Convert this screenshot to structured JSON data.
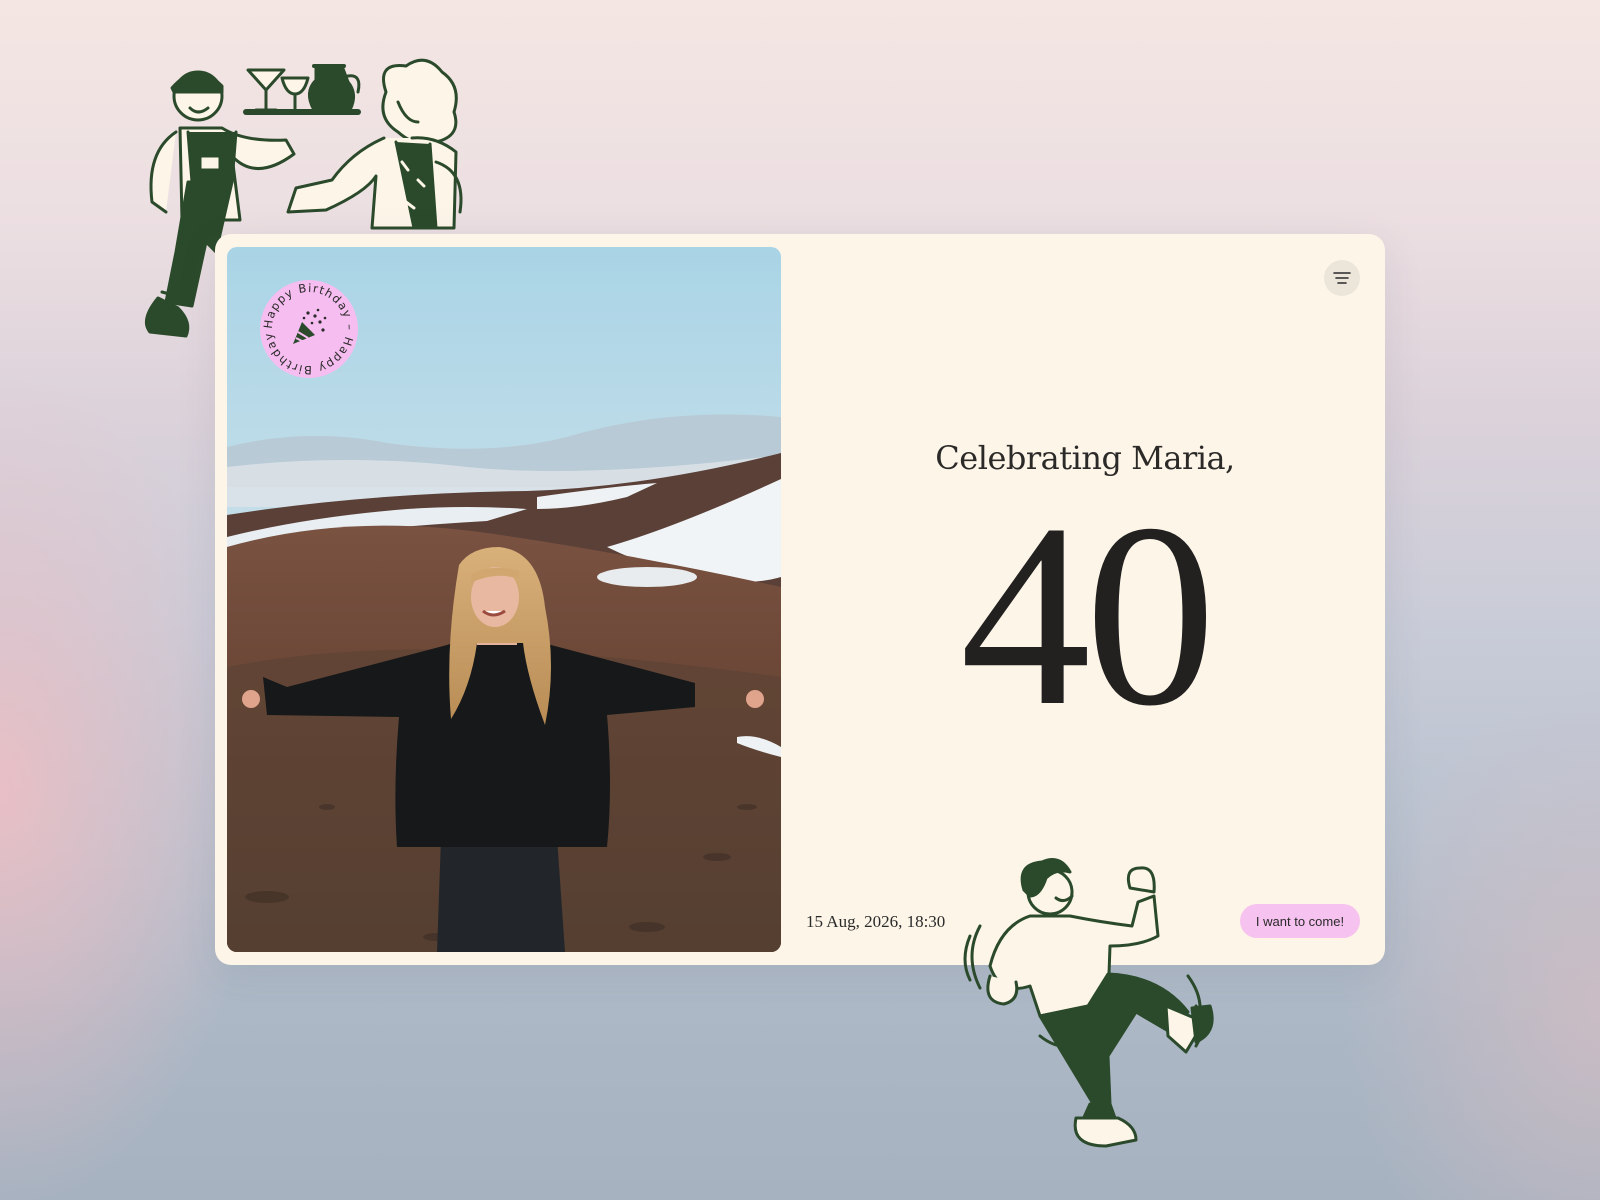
{
  "badge": {
    "text": "Happy Birthday – Happy Birthday – "
  },
  "heading": {
    "subtitle": "Celebrating Maria,",
    "age": "40"
  },
  "event": {
    "datetime": "15 Aug, 2026, 18:30"
  },
  "cta": {
    "label": "I want to come!"
  },
  "icons": [
    "menu-icon",
    "party-popper-icon"
  ],
  "colors": {
    "card": "#fcf5e8",
    "accent_pink": "#f6c2ef",
    "illustration_green": "#2b4a2b",
    "text": "#222120"
  }
}
